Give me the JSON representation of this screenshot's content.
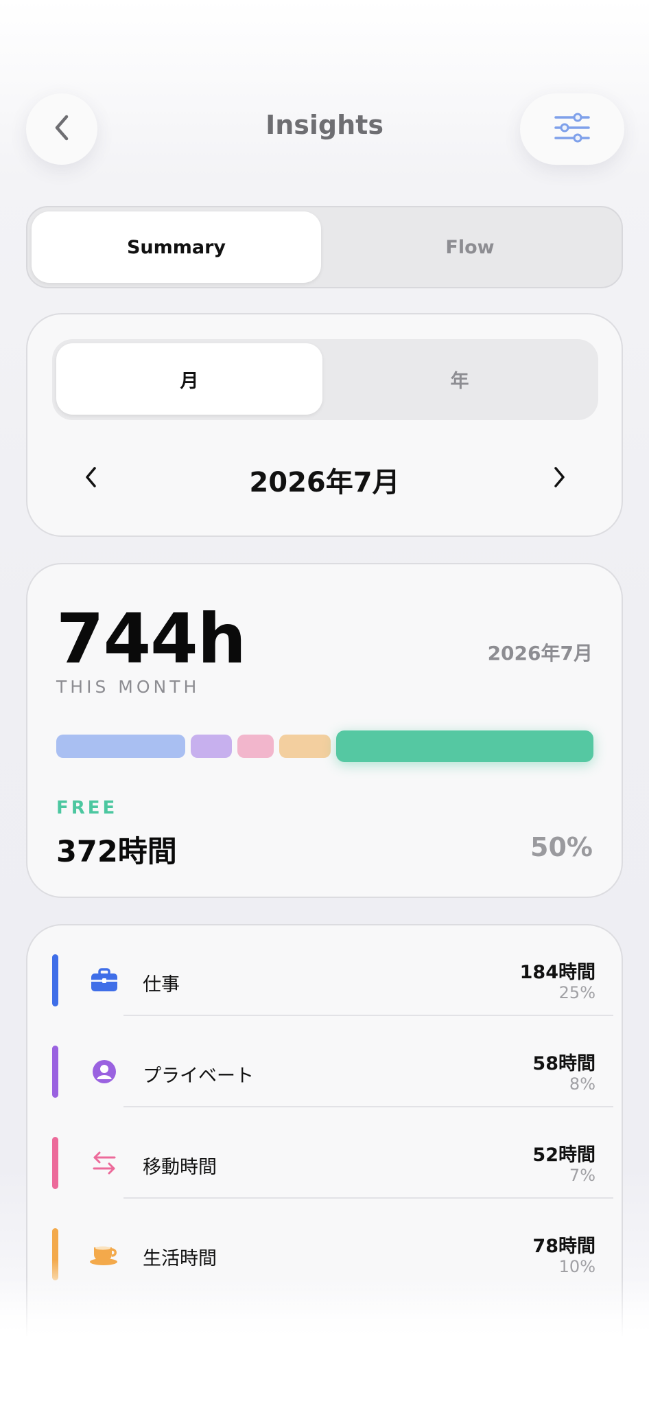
{
  "header": {
    "title": "Insights",
    "back_icon": "chevron-left-icon",
    "filter_icon": "sliders-icon"
  },
  "view_tabs": [
    {
      "label": "Summary",
      "active": true
    },
    {
      "label": "Flow",
      "active": false
    }
  ],
  "period": {
    "tabs": [
      {
        "label": "月",
        "active": true
      },
      {
        "label": "年",
        "active": false
      }
    ],
    "current": "2026年7月"
  },
  "summary": {
    "total": "744h",
    "period_label": "2026年7月",
    "caption": "THIS MONTH",
    "free_label": "FREE",
    "free_hours": "372時間",
    "free_percent": "50%",
    "bar_fractions": [
      {
        "name": "仕事",
        "fraction": 0.25,
        "color": "#a9bff2"
      },
      {
        "name": "プライベート",
        "fraction": 0.08,
        "color": "#c7b0ee"
      },
      {
        "name": "移動時間",
        "fraction": 0.07,
        "color": "#f2b6cc"
      },
      {
        "name": "生活時間",
        "fraction": 0.1,
        "color": "#f3cf9f"
      },
      {
        "name": "FREE",
        "fraction": 0.5,
        "color": "#55c8a2"
      }
    ]
  },
  "categories": [
    {
      "name": "仕事",
      "hours": "184時間",
      "percent": "25%",
      "color": "#3f6ee8",
      "icon": "briefcase-icon"
    },
    {
      "name": "プライベート",
      "hours": "58時間",
      "percent": "8%",
      "color": "#9a62e0",
      "icon": "person-icon"
    },
    {
      "name": "移動時間",
      "hours": "52時間",
      "percent": "7%",
      "color": "#ec6a9a",
      "icon": "swap-arrows-icon"
    },
    {
      "name": "生活時間",
      "hours": "78時間",
      "percent": "10%",
      "color": "#f3a94b",
      "icon": "coffee-cup-icon"
    }
  ]
}
